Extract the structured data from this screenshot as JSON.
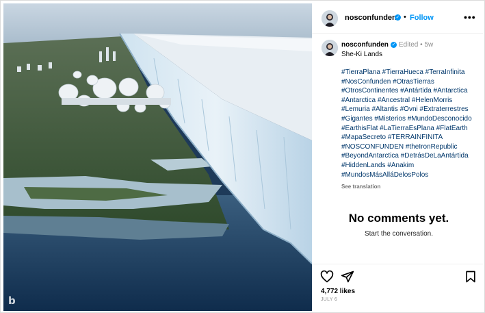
{
  "header": {
    "username": "nosconfunden",
    "separator": "•",
    "follow_label": "Follow",
    "more_label": "•••",
    "verified_glyph": "✓"
  },
  "post": {
    "username": "nosconfunden",
    "edited_label": "Edited",
    "dot": "•",
    "age": "5w",
    "title": "She-Ki Lands",
    "hashtags": [
      "#TierraPlana",
      "#TierraHueca",
      "#TerraInfinita",
      "#NosConfunden",
      "#OtrasTierras",
      "#OtrosContinentes",
      "#Antártida",
      "#Antarctica",
      "#Antarctica",
      "#Ancestral",
      "#HelenMorris",
      "#Lemuria",
      "#Altantis",
      "#Ovni",
      "#Extraterrestres",
      "#Gigantes",
      "#Misterios",
      "#MundoDesconocido",
      "#EarthisFlat",
      "#LaTierraEsPlana",
      "#FlatEarth",
      "#MapaSecreto",
      "#TERRAINFINITA",
      "#NOSCONFUNDEN",
      "#theIronRepublic",
      "#BeyondAntarctica",
      "#DetrásDeLaAntártida",
      "#HiddenLands",
      "#Anakim",
      "#MundosMásAlláDelosPolos"
    ],
    "see_translation": "See translation"
  },
  "comments": {
    "empty_title": "No comments yet.",
    "empty_subtitle": "Start the conversation."
  },
  "actions": {
    "likes_count": "4,772 likes",
    "date": "JULY 6"
  },
  "media": {
    "watermark": "b"
  },
  "colors": {
    "link": "#0095f6",
    "hashtag": "#00376b",
    "muted": "#8e8e8e"
  },
  "icons": [
    "more-icon",
    "heart-icon",
    "share-icon",
    "bookmark-icon",
    "verified-icon"
  ]
}
